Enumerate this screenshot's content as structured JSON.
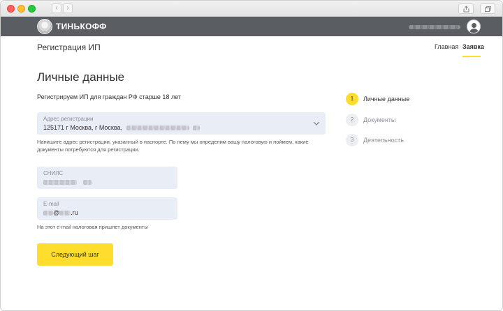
{
  "browser": {
    "back_icon": "‹",
    "forward_icon": "›"
  },
  "header": {
    "logo_text": "ТИНЬКОФФ",
    "accent_color": "#ffdd2d",
    "dark_color": "#5a5d62"
  },
  "subheader": {
    "title": "Регистрация ИП",
    "nav": [
      {
        "label": "Главная",
        "active": false
      },
      {
        "label": "Заявка",
        "active": true
      }
    ]
  },
  "page": {
    "title": "Личные данные",
    "subtitle": "Регистрируем ИП для граждан РФ старше 18 лет"
  },
  "form": {
    "address": {
      "label": "Адрес регистрации",
      "value_prefix": "125171 г Москва, г Москва,",
      "hint": "Напишите адрес регистрации, указанный в паспорте. По нему мы определим вашу налоговую и поймем, какие документы потребуются для регистрации."
    },
    "snils": {
      "label": "СНИЛС"
    },
    "email": {
      "label": "E-mail",
      "at": "@",
      "suffix": ".ru",
      "hint": "На этот e-mail налоговая пришлет документы"
    },
    "next_button": "Следующий шаг"
  },
  "steps": [
    {
      "number": "1",
      "label": "Личные данные",
      "active": true
    },
    {
      "number": "2",
      "label": "Документы",
      "active": false
    },
    {
      "number": "3",
      "label": "Деятельность",
      "active": false
    }
  ]
}
